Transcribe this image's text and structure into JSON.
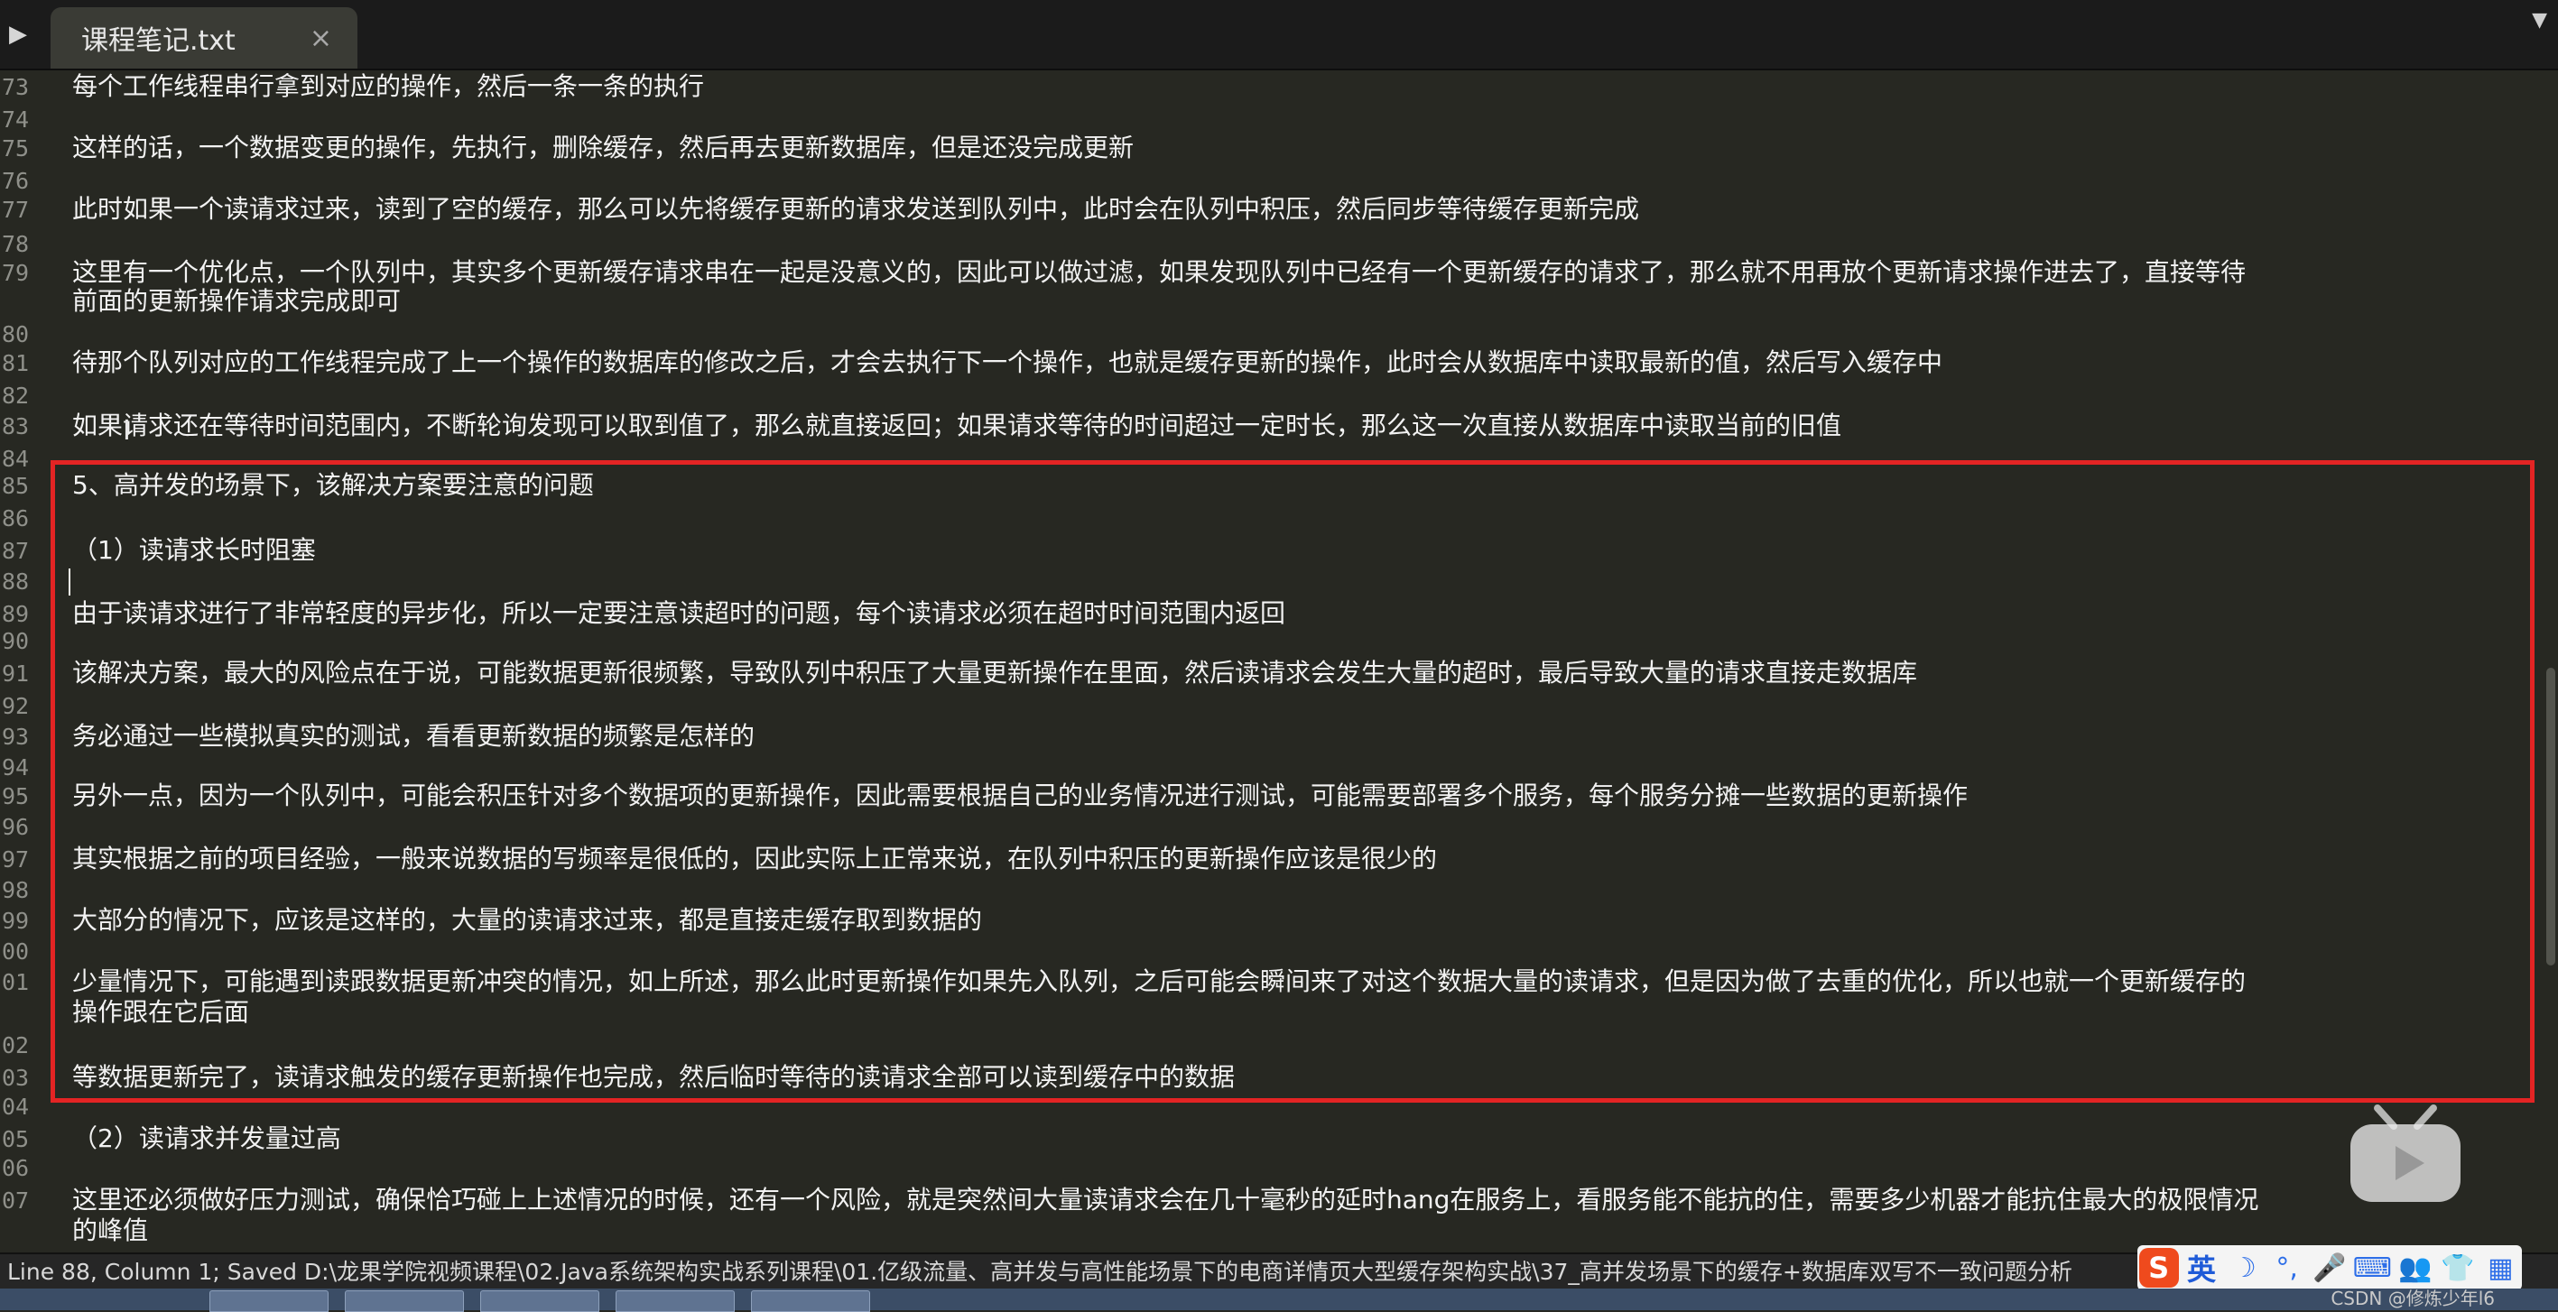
{
  "tabbar": {
    "tab_title": "课程笔记.txt",
    "close_glyph": "×",
    "sidebar_glyph": "▶",
    "dropdown_glyph": "▼"
  },
  "editor": {
    "lines": [
      {
        "n": "73",
        "text": "每个工作线程串行拿到对应的操作，然后一条一条的执行"
      },
      {
        "n": "74",
        "text": ""
      },
      {
        "n": "75",
        "text": "这样的话，一个数据变更的操作，先执行，删除缓存，然后再去更新数据库，但是还没完成更新"
      },
      {
        "n": "76",
        "text": ""
      },
      {
        "n": "77",
        "text": "此时如果一个读请求过来，读到了空的缓存，那么可以先将缓存更新的请求发送到队列中，此时会在队列中积压，然后同步等待缓存更新完成"
      },
      {
        "n": "78",
        "text": ""
      },
      {
        "n": "79",
        "text": "这里有一个优化点，一个队列中，其实多个更新缓存请求串在一起是没意义的，因此可以做过滤，如果发现队列中已经有一个更新缓存的请求了，那么就不用再放个更新请求操作进去了，直接等待"
      },
      {
        "n": "",
        "text": "前面的更新操作请求完成即可"
      },
      {
        "n": "80",
        "text": ""
      },
      {
        "n": "81",
        "text": "待那个队列对应的工作线程完成了上一个操作的数据库的修改之后，才会去执行下一个操作，也就是缓存更新的操作，此时会从数据库中读取最新的值，然后写入缓存中"
      },
      {
        "n": "82",
        "text": ""
      },
      {
        "n": "83",
        "text": "如果请求还在等待时间范围内，不断轮询发现可以取到值了，那么就直接返回；如果请求等待的时间超过一定时长，那么这一次直接从数据库中读取当前的旧值"
      },
      {
        "n": "84",
        "text": ""
      },
      {
        "n": "85",
        "text": "5、高并发的场景下，该解决方案要注意的问题"
      },
      {
        "n": "86",
        "text": ""
      },
      {
        "n": "87",
        "text": "（1）读请求长时阻塞"
      },
      {
        "n": "88",
        "text": ""
      },
      {
        "n": "89",
        "text": "由于读请求进行了非常轻度的异步化，所以一定要注意读超时的问题，每个读请求必须在超时时间范围内返回"
      },
      {
        "n": "90",
        "text": ""
      },
      {
        "n": "91",
        "text": "该解决方案，最大的风险点在于说，可能数据更新很频繁，导致队列中积压了大量更新操作在里面，然后读请求会发生大量的超时，最后导致大量的请求直接走数据库"
      },
      {
        "n": "92",
        "text": ""
      },
      {
        "n": "93",
        "text": "务必通过一些模拟真实的测试，看看更新数据的频繁是怎样的"
      },
      {
        "n": "94",
        "text": ""
      },
      {
        "n": "95",
        "text": "另外一点，因为一个队列中，可能会积压针对多个数据项的更新操作，因此需要根据自己的业务情况进行测试，可能需要部署多个服务，每个服务分摊一些数据的更新操作"
      },
      {
        "n": "96",
        "text": ""
      },
      {
        "n": "97",
        "text": "其实根据之前的项目经验，一般来说数据的写频率是很低的，因此实际上正常来说，在队列中积压的更新操作应该是很少的"
      },
      {
        "n": "98",
        "text": ""
      },
      {
        "n": "99",
        "text": "大部分的情况下，应该是这样的，大量的读请求过来，都是直接走缓存取到数据的"
      },
      {
        "n": "00",
        "text": ""
      },
      {
        "n": "01",
        "text": "少量情况下，可能遇到读跟数据更新冲突的情况，如上所述，那么此时更新操作如果先入队列，之后可能会瞬间来了对这个数据大量的读请求，但是因为做了去重的优化，所以也就一个更新缓存的"
      },
      {
        "n": "",
        "text": "操作跟在它后面"
      },
      {
        "n": "02",
        "text": ""
      },
      {
        "n": "03",
        "text": "等数据更新完了，读请求触发的缓存更新操作也完成，然后临时等待的读请求全部可以读到缓存中的数据"
      },
      {
        "n": "04",
        "text": ""
      },
      {
        "n": "05",
        "text": "（2）读请求并发量过高"
      },
      {
        "n": "06",
        "text": ""
      },
      {
        "n": "07",
        "text": "这里还必须做好压力测试，确保恰巧碰上上述情况的时候，还有一个风险，就是突然间大量读请求会在几十毫秒的延时hang在服务上，看服务能不能抗的住，需要多少机器才能抗住最大的极限情况"
      },
      {
        "n": "",
        "text": "的峰值"
      }
    ]
  },
  "statusbar": {
    "text": "Line 88, Column 1; Saved D:\\龙果学院视频课程\\02.Java系统架构实战系列课程\\01.亿级流量、高并发与高性能场景下的电商详情页大型缓存架构实战\\37_高并发场景下的缓存+数据库双写不一致问题分析"
  },
  "ime": {
    "logo": "S",
    "lang": "英",
    "items": [
      "☽",
      "°,",
      "🎤",
      "⌨",
      "👥",
      "👕",
      "▦"
    ]
  },
  "watermark": "CSDN @修炼少年l6",
  "colors": {
    "editor_bg": "#272822",
    "highlight": "#e32424",
    "ime_logo": "#ef4a1d"
  }
}
